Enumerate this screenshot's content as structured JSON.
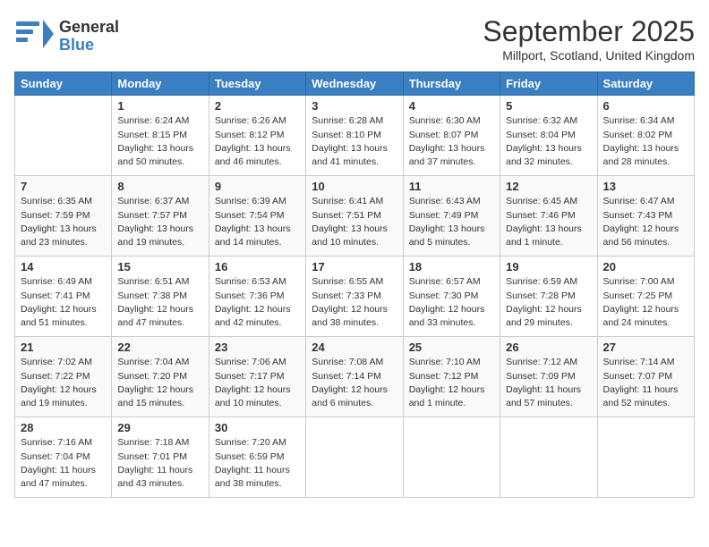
{
  "header": {
    "logo_line1": "General",
    "logo_line2": "Blue",
    "title": "September 2025",
    "subtitle": "Millport, Scotland, United Kingdom"
  },
  "calendar": {
    "days_of_week": [
      "Sunday",
      "Monday",
      "Tuesday",
      "Wednesday",
      "Thursday",
      "Friday",
      "Saturday"
    ],
    "weeks": [
      [
        {
          "day": "",
          "details": ""
        },
        {
          "day": "1",
          "details": "Sunrise: 6:24 AM\nSunset: 8:15 PM\nDaylight: 13 hours\nand 50 minutes."
        },
        {
          "day": "2",
          "details": "Sunrise: 6:26 AM\nSunset: 8:12 PM\nDaylight: 13 hours\nand 46 minutes."
        },
        {
          "day": "3",
          "details": "Sunrise: 6:28 AM\nSunset: 8:10 PM\nDaylight: 13 hours\nand 41 minutes."
        },
        {
          "day": "4",
          "details": "Sunrise: 6:30 AM\nSunset: 8:07 PM\nDaylight: 13 hours\nand 37 minutes."
        },
        {
          "day": "5",
          "details": "Sunrise: 6:32 AM\nSunset: 8:04 PM\nDaylight: 13 hours\nand 32 minutes."
        },
        {
          "day": "6",
          "details": "Sunrise: 6:34 AM\nSunset: 8:02 PM\nDaylight: 13 hours\nand 28 minutes."
        }
      ],
      [
        {
          "day": "7",
          "details": "Sunrise: 6:35 AM\nSunset: 7:59 PM\nDaylight: 13 hours\nand 23 minutes."
        },
        {
          "day": "8",
          "details": "Sunrise: 6:37 AM\nSunset: 7:57 PM\nDaylight: 13 hours\nand 19 minutes."
        },
        {
          "day": "9",
          "details": "Sunrise: 6:39 AM\nSunset: 7:54 PM\nDaylight: 13 hours\nand 14 minutes."
        },
        {
          "day": "10",
          "details": "Sunrise: 6:41 AM\nSunset: 7:51 PM\nDaylight: 13 hours\nand 10 minutes."
        },
        {
          "day": "11",
          "details": "Sunrise: 6:43 AM\nSunset: 7:49 PM\nDaylight: 13 hours\nand 5 minutes."
        },
        {
          "day": "12",
          "details": "Sunrise: 6:45 AM\nSunset: 7:46 PM\nDaylight: 13 hours\nand 1 minute."
        },
        {
          "day": "13",
          "details": "Sunrise: 6:47 AM\nSunset: 7:43 PM\nDaylight: 12 hours\nand 56 minutes."
        }
      ],
      [
        {
          "day": "14",
          "details": "Sunrise: 6:49 AM\nSunset: 7:41 PM\nDaylight: 12 hours\nand 51 minutes."
        },
        {
          "day": "15",
          "details": "Sunrise: 6:51 AM\nSunset: 7:38 PM\nDaylight: 12 hours\nand 47 minutes."
        },
        {
          "day": "16",
          "details": "Sunrise: 6:53 AM\nSunset: 7:36 PM\nDaylight: 12 hours\nand 42 minutes."
        },
        {
          "day": "17",
          "details": "Sunrise: 6:55 AM\nSunset: 7:33 PM\nDaylight: 12 hours\nand 38 minutes."
        },
        {
          "day": "18",
          "details": "Sunrise: 6:57 AM\nSunset: 7:30 PM\nDaylight: 12 hours\nand 33 minutes."
        },
        {
          "day": "19",
          "details": "Sunrise: 6:59 AM\nSunset: 7:28 PM\nDaylight: 12 hours\nand 29 minutes."
        },
        {
          "day": "20",
          "details": "Sunrise: 7:00 AM\nSunset: 7:25 PM\nDaylight: 12 hours\nand 24 minutes."
        }
      ],
      [
        {
          "day": "21",
          "details": "Sunrise: 7:02 AM\nSunset: 7:22 PM\nDaylight: 12 hours\nand 19 minutes."
        },
        {
          "day": "22",
          "details": "Sunrise: 7:04 AM\nSunset: 7:20 PM\nDaylight: 12 hours\nand 15 minutes."
        },
        {
          "day": "23",
          "details": "Sunrise: 7:06 AM\nSunset: 7:17 PM\nDaylight: 12 hours\nand 10 minutes."
        },
        {
          "day": "24",
          "details": "Sunrise: 7:08 AM\nSunset: 7:14 PM\nDaylight: 12 hours\nand 6 minutes."
        },
        {
          "day": "25",
          "details": "Sunrise: 7:10 AM\nSunset: 7:12 PM\nDaylight: 12 hours\nand 1 minute."
        },
        {
          "day": "26",
          "details": "Sunrise: 7:12 AM\nSunset: 7:09 PM\nDaylight: 11 hours\nand 57 minutes."
        },
        {
          "day": "27",
          "details": "Sunrise: 7:14 AM\nSunset: 7:07 PM\nDaylight: 11 hours\nand 52 minutes."
        }
      ],
      [
        {
          "day": "28",
          "details": "Sunrise: 7:16 AM\nSunset: 7:04 PM\nDaylight: 11 hours\nand 47 minutes."
        },
        {
          "day": "29",
          "details": "Sunrise: 7:18 AM\nSunset: 7:01 PM\nDaylight: 11 hours\nand 43 minutes."
        },
        {
          "day": "30",
          "details": "Sunrise: 7:20 AM\nSunset: 6:59 PM\nDaylight: 11 hours\nand 38 minutes."
        },
        {
          "day": "",
          "details": ""
        },
        {
          "day": "",
          "details": ""
        },
        {
          "day": "",
          "details": ""
        },
        {
          "day": "",
          "details": ""
        }
      ]
    ]
  }
}
